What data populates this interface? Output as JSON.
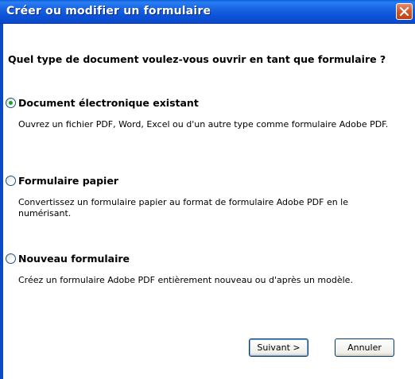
{
  "window": {
    "title": "Créer ou modifier un formulaire"
  },
  "question": "Quel type de document voulez-vous ouvrir en tant que formulaire ?",
  "options": [
    {
      "label": "Document électronique existant",
      "description": "Ouvrez un fichier PDF, Word, Excel ou d'un autre type comme formulaire Adobe PDF.",
      "selected": true
    },
    {
      "label": "Formulaire papier",
      "description": "Convertissez un formulaire papier au format de formulaire Adobe PDF en le numérisant.",
      "selected": false
    },
    {
      "label": "Nouveau formulaire",
      "description": "Créez un formulaire Adobe PDF entièrement nouveau ou d'après un modèle.",
      "selected": false
    }
  ],
  "buttons": {
    "next": "Suivant >",
    "cancel": "Annuler"
  },
  "icons": {
    "close": "close-icon"
  },
  "colors": {
    "titlebar": "#0c52d8",
    "close": "#d55a2e",
    "radio_dot": "#21a121"
  }
}
